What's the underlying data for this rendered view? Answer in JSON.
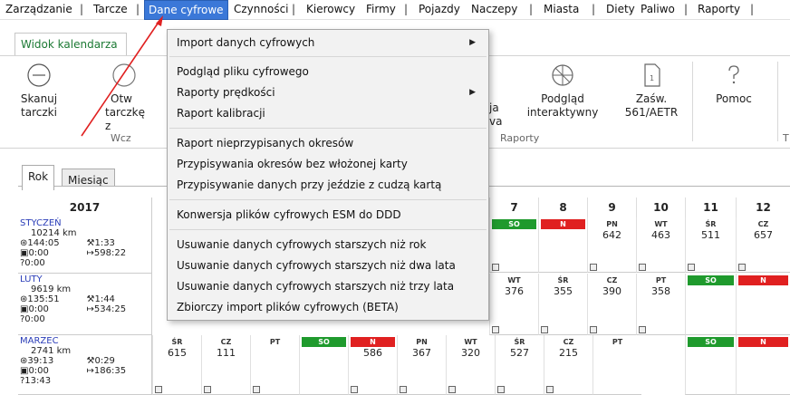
{
  "menubar": {
    "items": [
      "Zarządzanie",
      "Tarcze",
      "Dane cyfrowe",
      "Czynności",
      "Kierowcy",
      "Firmy",
      "Pojazdy",
      "Naczepy",
      "Miasta",
      "Diety",
      "Paliwo",
      "Raporty"
    ],
    "separator": "|"
  },
  "ribbon_tab": "Widok kalendarza",
  "ribbon": {
    "scan": "Skanuj tarczki",
    "open_left": "Otw",
    "open_left2": "tarczkę z",
    "group_left": "Wcz",
    "partial1": "ja",
    "partial2": "va",
    "preview": "Podgląd",
    "preview2": "interaktywny",
    "cert": "Zaśw.",
    "cert2": "561/AETR",
    "help": "Pomoc",
    "group_reports": "Raporty",
    "group_t": "T"
  },
  "dropdown": {
    "import": "Import danych cyfrowych",
    "preview_file": "Podgląd pliku cyfrowego",
    "speed_reports": "Raporty prędkości",
    "calibration": "Raport kalibracji",
    "unassigned": "Raport nieprzypisanych okresów",
    "assign_no_card": "Przypisywania okresów bez włożonej karty",
    "assign_foreign": "Przypisywanie danych przy jeździe z cudzą kartą",
    "convert": "Konwersja plików cyfrowych ESM do DDD",
    "del_1": "Usuwanie danych cyfrowych starszych niż rok",
    "del_2": "Usuwanie danych cyfrowych starszych niż dwa lata",
    "del_3": "Usuwanie danych cyfrowych starszych niż trzy lata",
    "bulk": "Zbiorczy import plików cyfrowych (BETA)"
  },
  "view_tabs": {
    "year": "Rok",
    "month": "Miesiąc"
  },
  "calendar": {
    "year": "2017",
    "day_headers": [
      "7",
      "8",
      "9",
      "10",
      "11",
      "12"
    ],
    "months": [
      {
        "name": "STYCZEŃ",
        "km": "10214 km",
        "t1": "⊛144:05",
        "t2": "⚒1:33",
        "t3": "▣0:00",
        "t4": "↦598:22",
        "t5": "?0:00"
      },
      {
        "name": "LUTY",
        "km": "9619 km",
        "t1": "⊛135:51",
        "t2": "⚒1:44",
        "t3": "▣0:00",
        "t4": "↦534:25",
        "t5": "?0:00"
      },
      {
        "name": "MARZEC",
        "km": "2741 km",
        "t1": "⊛39:13",
        "t2": "⚒0:29",
        "t3": "▣0:00",
        "t4": "↦186:35",
        "t5": "?13:43"
      }
    ],
    "row1": [
      {
        "d": "SO",
        "v": "",
        "c": "so"
      },
      {
        "d": "N",
        "v": "",
        "c": "n"
      },
      {
        "d": "PN",
        "v": "642",
        "c": ""
      },
      {
        "d": "WT",
        "v": "463",
        "c": ""
      },
      {
        "d": "ŚR",
        "v": "511",
        "c": ""
      },
      {
        "d": "CZ",
        "v": "657",
        "c": ""
      }
    ],
    "row2": [
      {
        "d": "WT",
        "v": "376",
        "c": ""
      },
      {
        "d": "ŚR",
        "v": "355",
        "c": ""
      },
      {
        "d": "CZ",
        "v": "390",
        "c": ""
      },
      {
        "d": "PT",
        "v": "358",
        "c": ""
      },
      {
        "d": "SO",
        "v": "",
        "c": "so"
      },
      {
        "d": "N",
        "v": "",
        "c": "n"
      }
    ],
    "row3_left": [
      {
        "d": "ŚR",
        "v": "615",
        "c": ""
      },
      {
        "d": "CZ",
        "v": "111",
        "c": ""
      },
      {
        "d": "PT",
        "v": "",
        "c": ""
      },
      {
        "d": "SO",
        "v": "",
        "c": "so"
      },
      {
        "d": "N",
        "v": "586",
        "c": "n"
      },
      {
        "d": "PN",
        "v": "367",
        "c": ""
      }
    ],
    "row3_right": [
      {
        "d": "WT",
        "v": "320",
        "c": ""
      },
      {
        "d": "ŚR",
        "v": "527",
        "c": ""
      },
      {
        "d": "CZ",
        "v": "215",
        "c": ""
      },
      {
        "d": "PT",
        "v": "",
        "c": ""
      },
      {
        "d": "SO",
        "v": "",
        "c": "so"
      },
      {
        "d": "N",
        "v": "",
        "c": "n"
      }
    ]
  }
}
